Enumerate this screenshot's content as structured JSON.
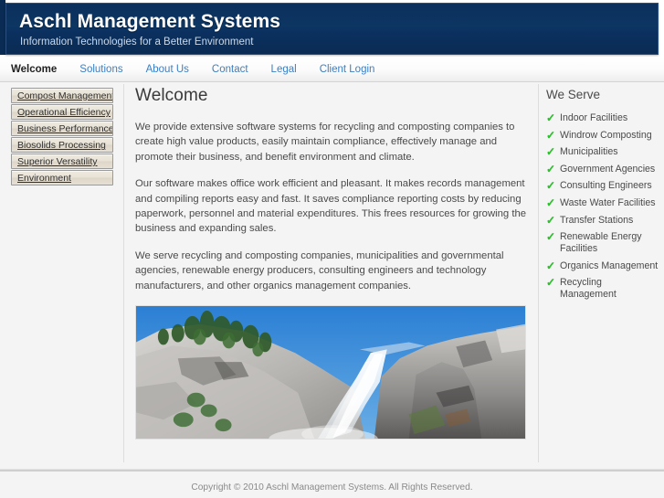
{
  "header": {
    "title": "Aschl Management Systems",
    "tagline": "Information Technologies for a Better Environment"
  },
  "nav": {
    "items": [
      {
        "label": "Welcome",
        "active": true
      },
      {
        "label": "Solutions",
        "active": false
      },
      {
        "label": "About Us",
        "active": false
      },
      {
        "label": "Contact",
        "active": false
      },
      {
        "label": "Legal",
        "active": false
      },
      {
        "label": "Client Login",
        "active": false
      }
    ]
  },
  "sidebar": {
    "items": [
      {
        "label": "Compost Management"
      },
      {
        "label": "Operational Efficiency"
      },
      {
        "label": "Business Performance"
      },
      {
        "label": "Biosolids Processing"
      },
      {
        "label": "Superior Versatility"
      },
      {
        "label": "Environment"
      }
    ]
  },
  "main": {
    "title": "Welcome",
    "paragraphs": [
      "We provide extensive software systems for recycling and composting companies to create high value products, easily maintain compliance, effectively manage and promote their business, and benefit environment and climate.",
      "Our software makes office work efficient and pleasant. It makes records management and compiling reports easy and fast. It  saves compliance reporting costs by reducing paperwork, personnel and material expenditures. This frees resources for growing the business and expanding sales.",
      "We serve recycling and composting companies, municipalities and governmental agencies, renewable energy producers, consulting engineers and technology manufacturers, and other organics management companies."
    ],
    "image_alt": "waterfall-photo"
  },
  "aside": {
    "title": "We Serve",
    "icon": "check-icon",
    "items": [
      {
        "label": "Indoor Facilities"
      },
      {
        "label": "Windrow Composting"
      },
      {
        "label": "Municipalities"
      },
      {
        "label": "Government Agencies"
      },
      {
        "label": "Consulting Engineers"
      },
      {
        "label": "Waste Water Facilities"
      },
      {
        "label": "Transfer Stations"
      },
      {
        "label": "Renewable Energy Facilities"
      },
      {
        "label": "Organics Management"
      },
      {
        "label": "Recycling Management"
      }
    ]
  },
  "footer": {
    "copyright": "Copyright © 2010 Aschl Management Systems. All Rights Reserved."
  },
  "colors": {
    "header_navy": "#0d3663",
    "link_blue": "#3b7fc4",
    "check_green": "#2fbf2f",
    "page_bg": "#f4f4f4",
    "divider": "#dddddd"
  }
}
